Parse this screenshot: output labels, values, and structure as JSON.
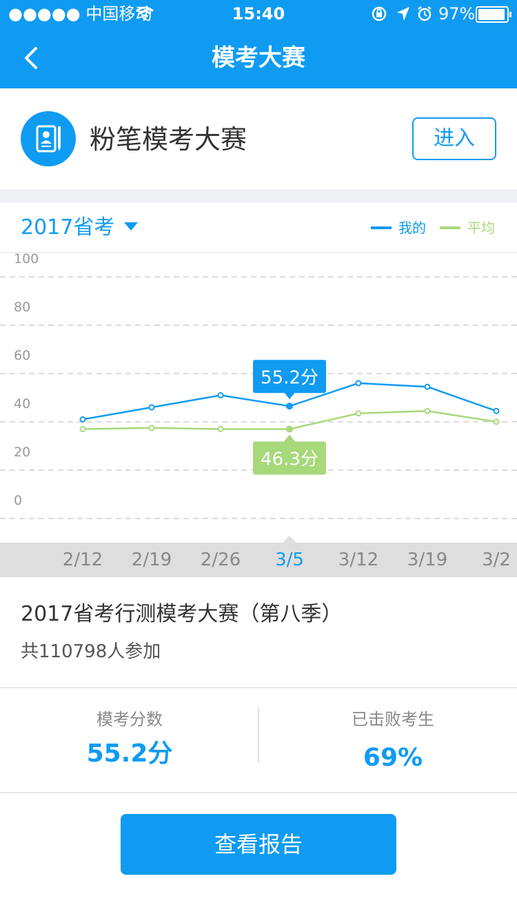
{
  "status_bar": {
    "carrier": "●●●●● 中国移动",
    "time": "15:40",
    "battery": "97%"
  },
  "nav": {
    "title": "模考大赛",
    "back_icon": "chevron-left-icon"
  },
  "header": {
    "title": "粉笔模考大赛",
    "enter_label": "进入",
    "logo_icon": "contact-book-icon"
  },
  "chart_head": {
    "exam_label": "2017省考",
    "legend": {
      "mine": "我的",
      "average": "平均"
    }
  },
  "colors": {
    "accent": "#0f9bf2",
    "average": "#a7d87a",
    "grid": "#cfcfcf"
  },
  "chart_data": {
    "type": "line",
    "ylim": [
      -10,
      110
    ],
    "y_ticks": [
      100,
      80,
      60,
      40,
      20,
      0
    ],
    "categories": [
      "2/12",
      "2/19",
      "2/26",
      "3/5",
      "3/12",
      "3/19",
      "3/2"
    ],
    "series": [
      {
        "name": "我的",
        "values": [
          41,
          46,
          51,
          46.5,
          56,
          54.5,
          44.5
        ]
      },
      {
        "name": "平均",
        "values": [
          37,
          37.5,
          37,
          37,
          43.5,
          44.5,
          40
        ]
      }
    ],
    "selected_index": 3,
    "selected_labels": {
      "mine": "55.2分",
      "average": "46.3分"
    }
  },
  "info": {
    "title": "2017省考行测模考大赛（第八季）",
    "participants": "共110798人参加"
  },
  "stats": {
    "score_label": "模考分数",
    "score_value": "55.2分",
    "beat_label": "已击败考生",
    "beat_value": "69%"
  },
  "report_button": "查看报告"
}
